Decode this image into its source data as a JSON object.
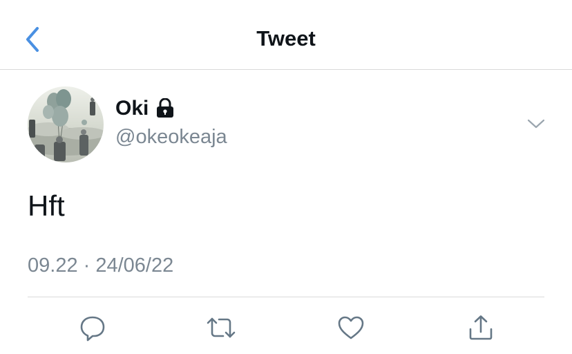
{
  "header": {
    "title": "Tweet",
    "back_icon": "chevron-left-icon",
    "accent_color": "#4a90e2"
  },
  "tweet": {
    "author_name": "Oki",
    "author_handle": "@okeokeaja",
    "protected_icon": "lock-icon",
    "text": "Hft",
    "timestamp": "09.22 · 24/06/22",
    "menu_icon": "chevron-down-icon"
  },
  "actions": [
    {
      "name": "reply",
      "icon": "reply-icon"
    },
    {
      "name": "retweet",
      "icon": "retweet-icon"
    },
    {
      "name": "like",
      "icon": "heart-icon"
    },
    {
      "name": "share",
      "icon": "share-icon"
    }
  ],
  "colors": {
    "text": "#0f1419",
    "secondary_text": "#7b8792",
    "divider": "#d9d9d9",
    "icon": "#657786"
  }
}
